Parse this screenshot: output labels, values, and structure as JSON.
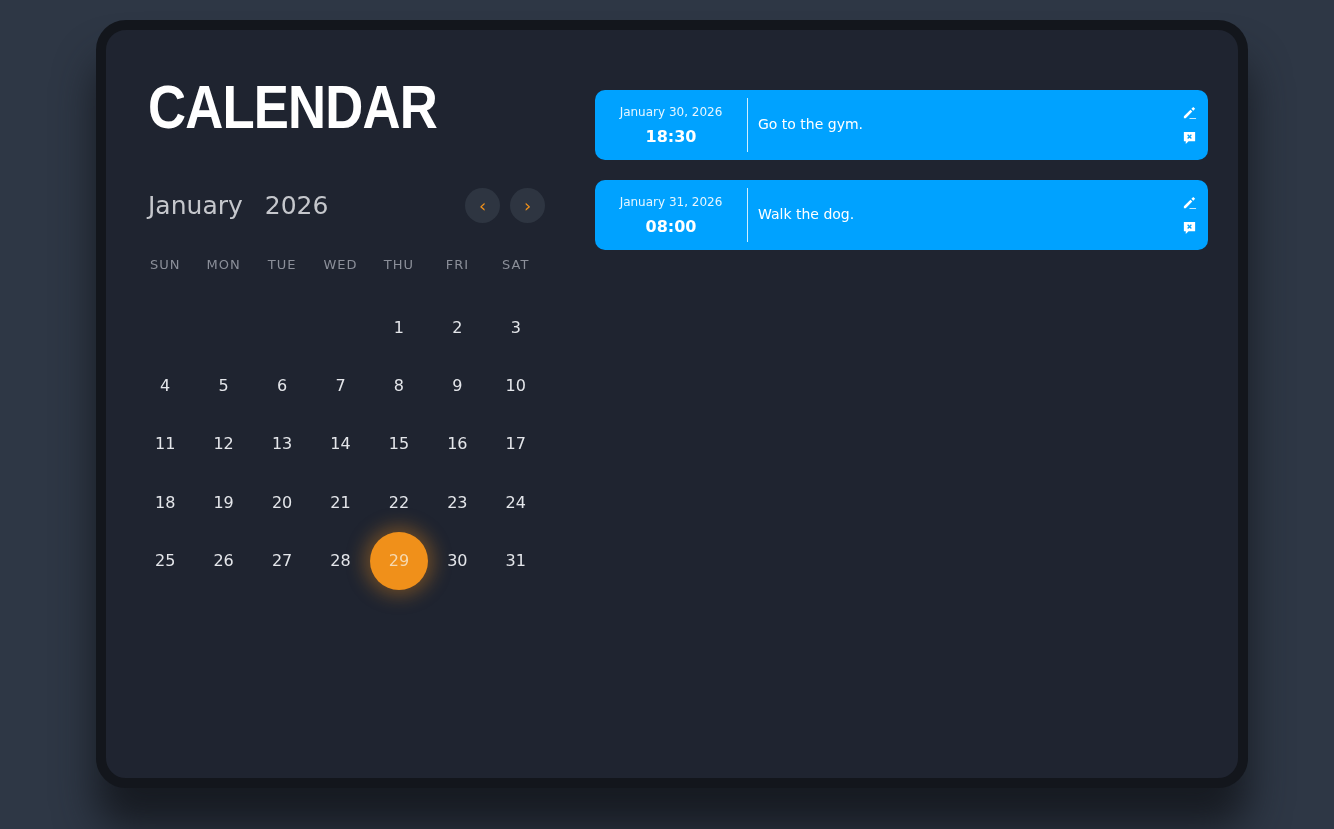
{
  "title": "CALENDAR",
  "month": "January",
  "year": "2026",
  "nav": {
    "prev": "‹",
    "next": "›"
  },
  "weekdays": [
    "SUN",
    "MON",
    "TUE",
    "WED",
    "THU",
    "FRI",
    "SAT"
  ],
  "weeks": [
    [
      {
        "label": "1",
        "selected": false
      },
      {
        "label": "2",
        "selected": false
      },
      {
        "label": "3",
        "selected": false
      }
    ],
    [
      {
        "label": "4",
        "selected": false
      },
      {
        "label": "5",
        "selected": false
      },
      {
        "label": "6",
        "selected": false
      },
      {
        "label": "7",
        "selected": false
      },
      {
        "label": "8",
        "selected": false
      },
      {
        "label": "9",
        "selected": false
      },
      {
        "label": "10",
        "selected": false
      }
    ],
    [
      {
        "label": "11",
        "selected": false
      },
      {
        "label": "12",
        "selected": false
      },
      {
        "label": "13",
        "selected": false
      },
      {
        "label": "14",
        "selected": false
      },
      {
        "label": "15",
        "selected": false
      },
      {
        "label": "16",
        "selected": false
      },
      {
        "label": "17",
        "selected": false
      }
    ],
    [
      {
        "label": "18",
        "selected": false
      },
      {
        "label": "19",
        "selected": false
      },
      {
        "label": "20",
        "selected": false
      },
      {
        "label": "21",
        "selected": false
      },
      {
        "label": "22",
        "selected": false
      },
      {
        "label": "23",
        "selected": false
      },
      {
        "label": "24",
        "selected": false
      }
    ],
    [
      {
        "label": "25",
        "selected": false
      },
      {
        "label": "26",
        "selected": false
      },
      {
        "label": "27",
        "selected": false
      },
      {
        "label": "28",
        "selected": false
      },
      {
        "label": "29",
        "selected": true
      },
      {
        "label": "30",
        "selected": false
      },
      {
        "label": "31",
        "selected": false
      }
    ]
  ],
  "events": [
    {
      "date": "January 30, 2026",
      "time": "18:30",
      "text": "Go to the gym."
    },
    {
      "date": "January 31, 2026",
      "time": "08:00",
      "text": "Walk the dog."
    }
  ]
}
